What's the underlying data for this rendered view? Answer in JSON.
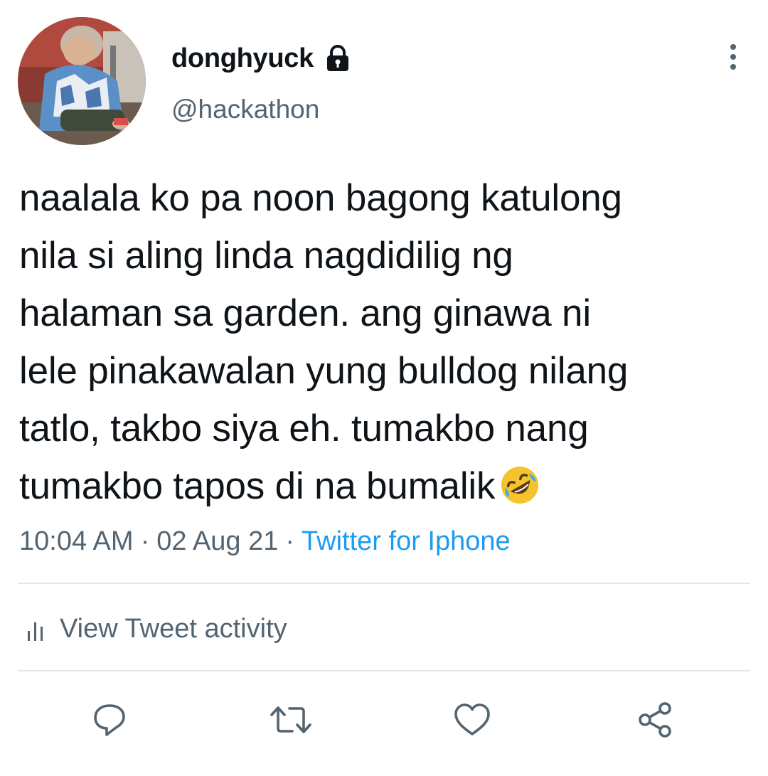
{
  "user": {
    "display_name": "donghyuck",
    "handle": "@hackathon",
    "protected_icon": "lock-icon",
    "avatar_icon": "avatar-photo"
  },
  "menu": {
    "icon": "more-vertical-icon"
  },
  "tweet": {
    "text": "naalala ko pa noon bagong katulong\nnila si aling linda nagdidilig ng\nhalaman sa garden. ang ginawa ni\nlele pinakawalan yung bulldog nilang\ntatlo, takbo siya eh. tumakbo nang\ntumakbo tapos di na bumalik",
    "emoji": "rolling-on-the-floor-laughing-emoji"
  },
  "meta": {
    "time": "10:04 AM",
    "separator": "·",
    "date": "02 Aug 21",
    "source": "Twitter for Iphone"
  },
  "activity": {
    "label": "View Tweet activity",
    "icon": "bar-chart-icon"
  },
  "actions": [
    {
      "name": "reply",
      "icon": "reply-icon"
    },
    {
      "name": "retweet",
      "icon": "retweet-icon"
    },
    {
      "name": "like",
      "icon": "heart-icon"
    },
    {
      "name": "share",
      "icon": "share-icon"
    }
  ],
  "colors": {
    "text": "#0f1419",
    "secondary": "#536471",
    "link": "#1d9bf0",
    "divider": "#e3e6e9",
    "emoji": "#f5c32c"
  }
}
